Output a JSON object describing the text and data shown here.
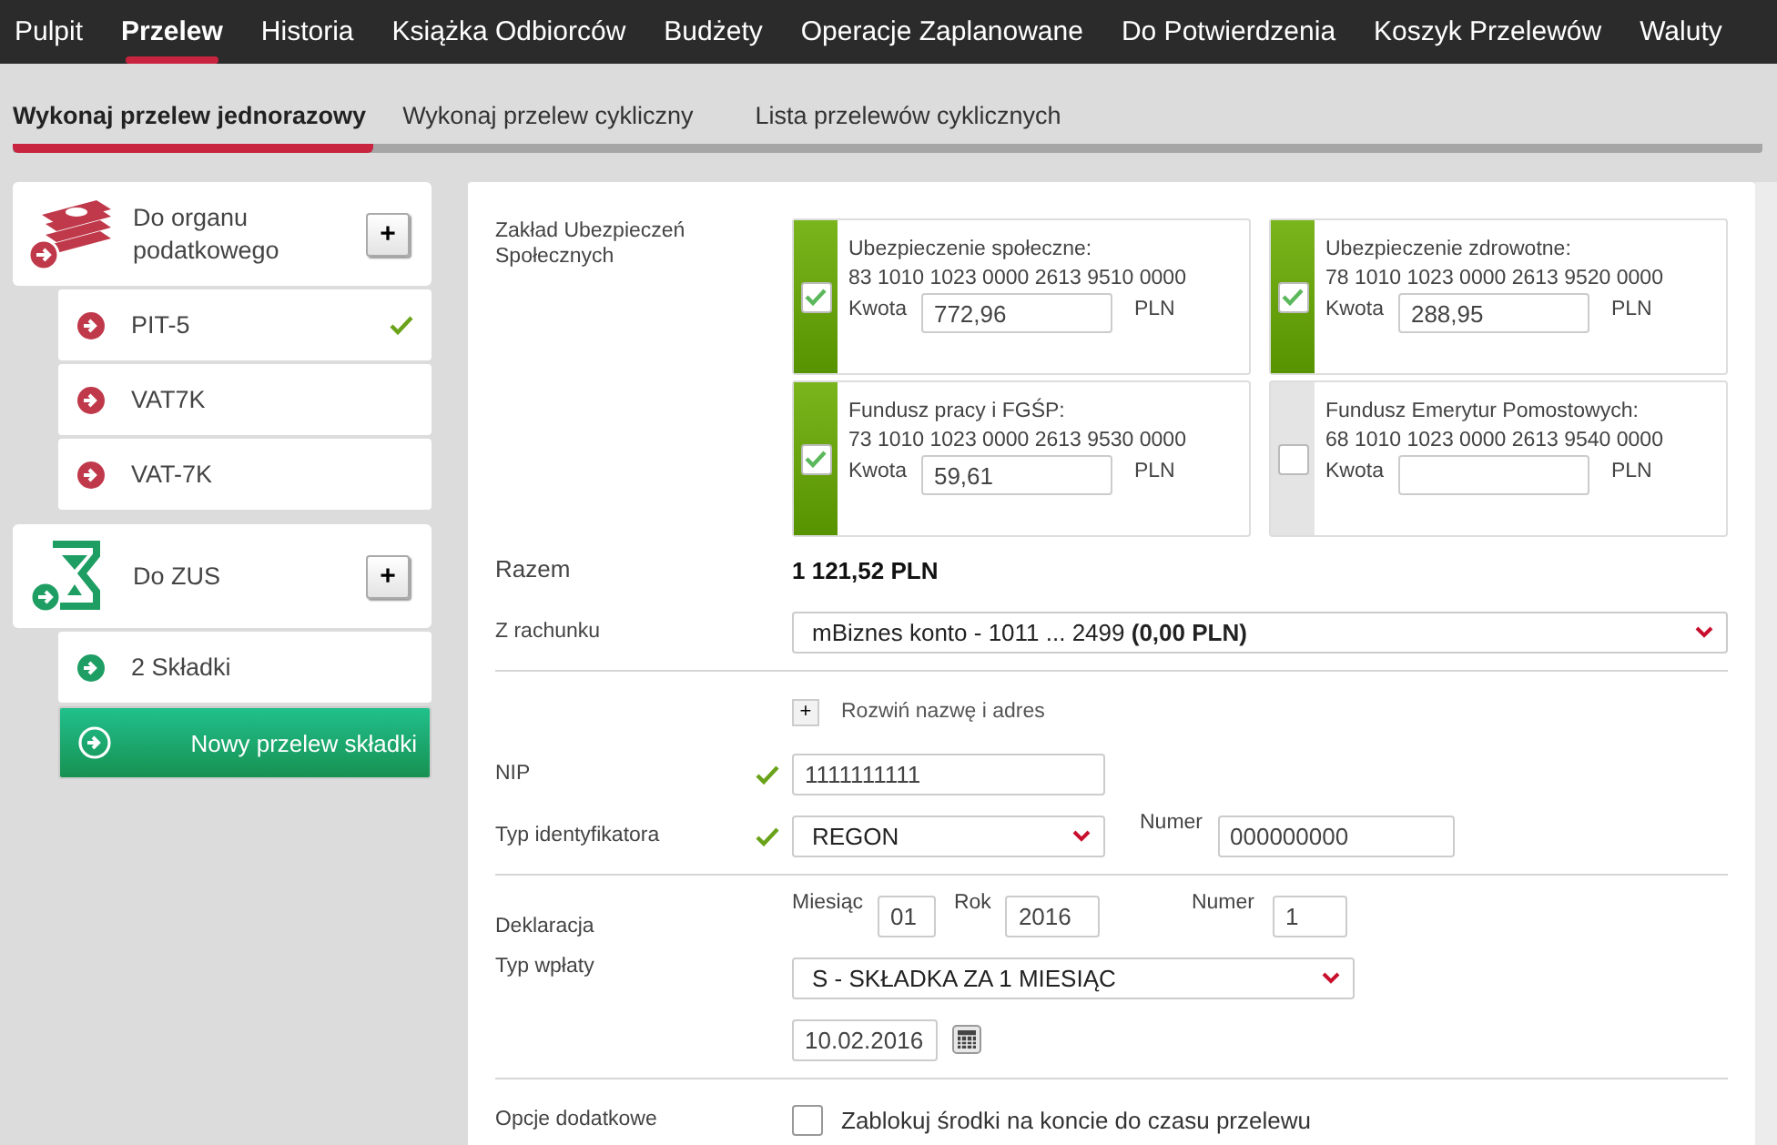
{
  "nav": {
    "items": [
      {
        "label": "Pulpit",
        "selected": false
      },
      {
        "label": "Przelew",
        "selected": true
      },
      {
        "label": "Historia",
        "selected": false
      },
      {
        "label": "Książka Odbiorców",
        "selected": false
      },
      {
        "label": "Budżety",
        "selected": false
      },
      {
        "label": "Operacje Zaplanowane",
        "selected": false
      },
      {
        "label": "Do Potwierdzenia",
        "selected": false
      },
      {
        "label": "Koszyk Przelewów",
        "selected": false
      },
      {
        "label": "Waluty",
        "selected": false
      }
    ]
  },
  "subtabs": [
    {
      "label": "Wykonaj przelew jednorazowy",
      "selected": true
    },
    {
      "label": "Wykonaj przelew cykliczny",
      "selected": false
    },
    {
      "label": "Lista przelewów cyklicznych",
      "selected": false
    }
  ],
  "sidebar": {
    "groups": [
      {
        "kind": "tax",
        "title": "Do organu podatkowego",
        "add": "+",
        "items": [
          {
            "label": "PIT-5",
            "checked": true,
            "selected": false
          },
          {
            "label": "VAT7K",
            "checked": false,
            "selected": false
          },
          {
            "label": "VAT-7K",
            "checked": false,
            "selected": false
          }
        ]
      },
      {
        "kind": "zus",
        "title": "Do ZUS",
        "add": "+",
        "items": [
          {
            "label": "2 Składki",
            "checked": false,
            "selected": false
          },
          {
            "label": "Nowy przelew składki",
            "checked": false,
            "selected": true
          }
        ]
      }
    ]
  },
  "form": {
    "zus_label": "Zakład Ubezpieczeń Społecznych",
    "contributions": [
      {
        "title": "Ubezpieczenie społeczne:",
        "account": "83 1010 1023 0000 2613 9510 0000",
        "amount_label": "Kwota",
        "amount": "772,96",
        "currency": "PLN",
        "checked": true
      },
      {
        "title": "Ubezpieczenie zdrowotne:",
        "account": "78 1010 1023 0000 2613 9520 0000",
        "amount_label": "Kwota",
        "amount": "288,95",
        "currency": "PLN",
        "checked": true
      },
      {
        "title": "Fundusz pracy i FGŚP:",
        "account": "73 1010 1023 0000 2613 9530 0000",
        "amount_label": "Kwota",
        "amount": "59,61",
        "currency": "PLN",
        "checked": true
      },
      {
        "title": "Fundusz Emerytur Pomostowych:",
        "account": "68 1010 1023 0000 2613 9540 0000",
        "amount_label": "Kwota",
        "currency": "PLN",
        "checked": false
      }
    ],
    "total": {
      "label": "Razem",
      "value": "1 121,52 PLN"
    },
    "from_account": {
      "label": "Z rachunku",
      "value": "mBiznes konto - 1011 ... 2499 **(0,00 PLN)**"
    },
    "expand": {
      "icon": "+",
      "label": "Rozwiń nazwę i adres"
    },
    "nip": {
      "label": "NIP",
      "value": "1111111111",
      "valid": true
    },
    "id_type": {
      "label": "Typ identyfikatora",
      "value": "REGON",
      "valid": true,
      "number_label": "Numer",
      "number": "000000000"
    },
    "declaration": {
      "label": "Deklaracja",
      "month_label": "Miesiąc",
      "month": "01",
      "year_label": "Rok",
      "year": "2016",
      "number_label": "Numer",
      "number": "1"
    },
    "payment_type": {
      "label": "Typ wpłaty",
      "value": "S - SKŁADKA ZA 1 MIESIĄC"
    },
    "date": "10.02.2016",
    "options": {
      "label": "Opcje dodatkowe",
      "checkbox_label": "Zablokuj środki na koncie do czasu przelewu",
      "checked": false
    }
  }
}
